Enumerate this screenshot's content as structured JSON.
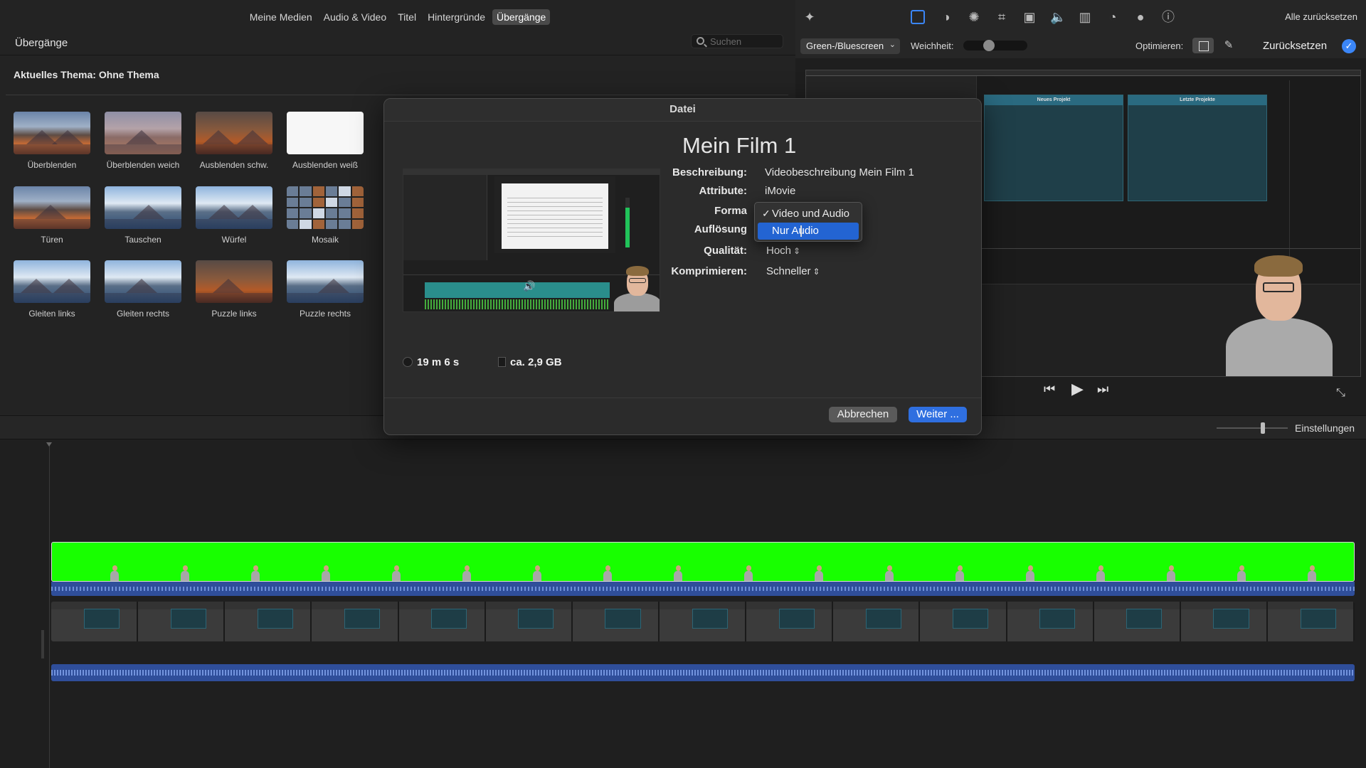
{
  "media_tabs": [
    "Meine Medien",
    "Audio & Video",
    "Titel",
    "Hintergründe",
    "Übergänge"
  ],
  "active_tab": "Übergänge",
  "browser": {
    "title": "Übergänge",
    "search_placeholder": "Suchen",
    "theme_label": "Aktuelles Thema: Ohne Thema"
  },
  "transitions": [
    {
      "label": "Überblenden",
      "icon": "mountain-lake-thumbnail"
    },
    {
      "label": "Überblenden weich",
      "icon": "mountain-lake-soft-thumbnail"
    },
    {
      "label": "Ausblenden schw.",
      "icon": "mountain-lake-dark-thumbnail"
    },
    {
      "label": "Ausblenden weiß",
      "icon": "white-thumbnail"
    },
    {
      "label": "Türen",
      "icon": "doors-thumbnail"
    },
    {
      "label": "Tauschen",
      "icon": "swap-thumbnail"
    },
    {
      "label": "Würfel",
      "icon": "cube-thumbnail"
    },
    {
      "label": "Mosaik",
      "icon": "mosaic-thumbnail"
    },
    {
      "label": "Gleiten links",
      "icon": "slide-left-thumbnail"
    },
    {
      "label": "Gleiten rechts",
      "icon": "slide-right-thumbnail"
    },
    {
      "label": "Puzzle links",
      "icon": "puzzle-left-thumbnail"
    },
    {
      "label": "Puzzle rechts",
      "icon": "puzzle-right-thumbnail"
    }
  ],
  "inspector": {
    "tools": [
      "magic-wand-icon",
      "video-overlay-icon",
      "color-balance-icon",
      "color-correction-icon",
      "crop-icon",
      "stabilization-icon",
      "volume-icon",
      "equalizer-icon",
      "speed-icon",
      "clip-filter-icon",
      "info-icon"
    ],
    "reset_all": "Alle zurücksetzen",
    "effect_select": "Green-/Bluescreen",
    "softness_label": "Weichheit:",
    "softness_value": 0.5,
    "optimize_label": "Optimieren:",
    "reset_label": "Zurücksetzen"
  },
  "viewer": {
    "mini_panel_a_title": "Neues Projekt",
    "mini_panel_b_title": "Letzte Projekte"
  },
  "playback": {
    "prev_icon": "skip-back-icon",
    "play_icon": "play-icon",
    "next_icon": "skip-forward-icon",
    "fullscreen_icon": "fullscreen-icon"
  },
  "timeline": {
    "settings_label": "Einstellungen",
    "zoom_value": 0.62
  },
  "dialog": {
    "title": "Datei",
    "film_title": "Mein Film 1",
    "description_label": "Beschreibung:",
    "description_value": "Videobeschreibung Mein Film 1",
    "attributes_label": "Attribute:",
    "attributes_value": "iMovie",
    "format_label": "Forma",
    "resolution_label": "Auflösung",
    "quality_label": "Qualität:",
    "quality_value": "Hoch",
    "compress_label": "Komprimieren:",
    "compress_value": "Schneller",
    "format_options": [
      {
        "label": "Video und Audio",
        "checked": true
      },
      {
        "label": "Nur Audio",
        "checked": false,
        "highlighted": true
      }
    ],
    "duration": "19 m 6 s",
    "size": "ca. 2,9 GB",
    "cancel_label": "Abbrechen",
    "next_label": "Weiter ..."
  },
  "colors": {
    "accent": "#2f6fe0",
    "green_screen": "#18ff00",
    "audio_waveform": "#2f4e9a",
    "menu_highlight": "#2364d2"
  }
}
